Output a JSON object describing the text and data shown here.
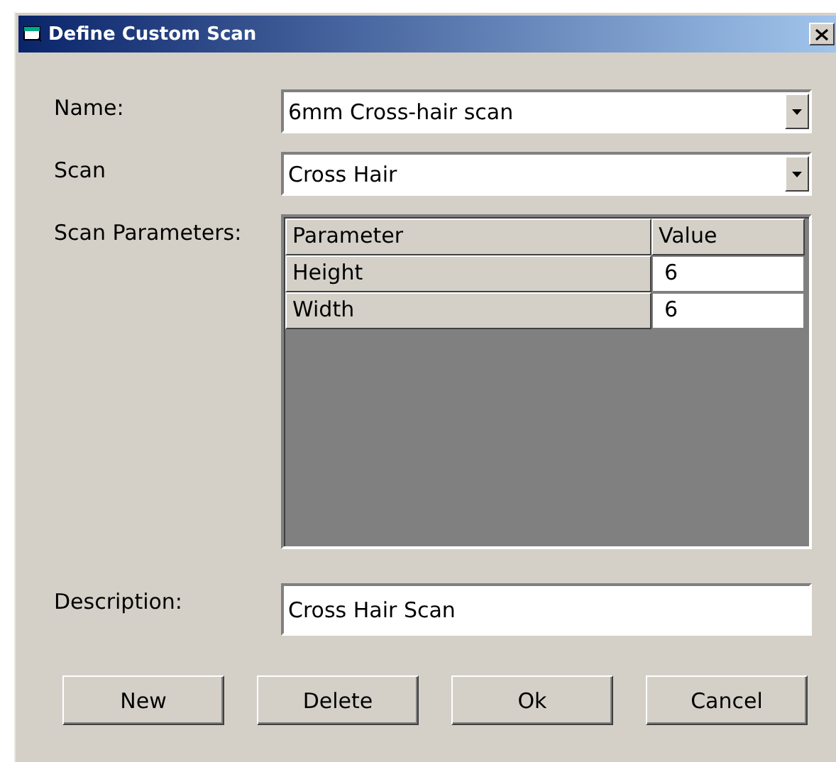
{
  "window": {
    "title": "Define Custom Scan"
  },
  "fields": [
    {
      "kind": "dropdown",
      "label": "Name:",
      "value": "6mm Cross-hair scan"
    },
    {
      "kind": "dropdown",
      "label": "Scan",
      "value": "Cross Hair"
    }
  ],
  "parameters": {
    "label": "Scan Parameters:",
    "columns": [
      "Parameter",
      "Value"
    ],
    "rows": [
      {
        "parameter": "Height",
        "value": "6"
      },
      {
        "parameter": "Width",
        "value": "6"
      }
    ]
  },
  "description": {
    "label": "Description:",
    "value": "Cross Hair Scan"
  },
  "buttons": [
    "New",
    "Delete",
    "Ok",
    "Cancel"
  ]
}
